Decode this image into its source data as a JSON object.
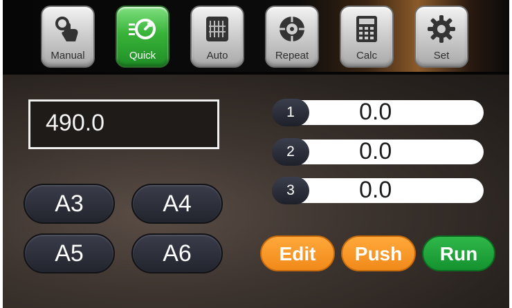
{
  "nav": [
    {
      "label": "Manual",
      "icon": "hand-pointer-icon",
      "active": false
    },
    {
      "label": "Quick",
      "icon": "fast-forward-clock-icon",
      "active": true
    },
    {
      "label": "Auto",
      "icon": "auto-program-icon",
      "active": false
    },
    {
      "label": "Repeat",
      "icon": "repeat-wheel-icon",
      "active": false
    },
    {
      "label": "Calc",
      "icon": "calculator-icon",
      "active": false
    },
    {
      "label": "Set",
      "icon": "gear-icon",
      "active": false
    }
  ],
  "display": {
    "value": "490.0"
  },
  "presets": [
    "A3",
    "A4",
    "A5",
    "A6"
  ],
  "fields": [
    {
      "num": "1",
      "value": "0.0"
    },
    {
      "num": "2",
      "value": "0.0"
    },
    {
      "num": "3",
      "value": "0.0"
    }
  ],
  "actions": {
    "edit": "Edit",
    "push": "Push",
    "run": "Run"
  },
  "colors": {
    "active_nav": "#39b339",
    "orange": "#f08a1a",
    "green": "#14922f"
  }
}
